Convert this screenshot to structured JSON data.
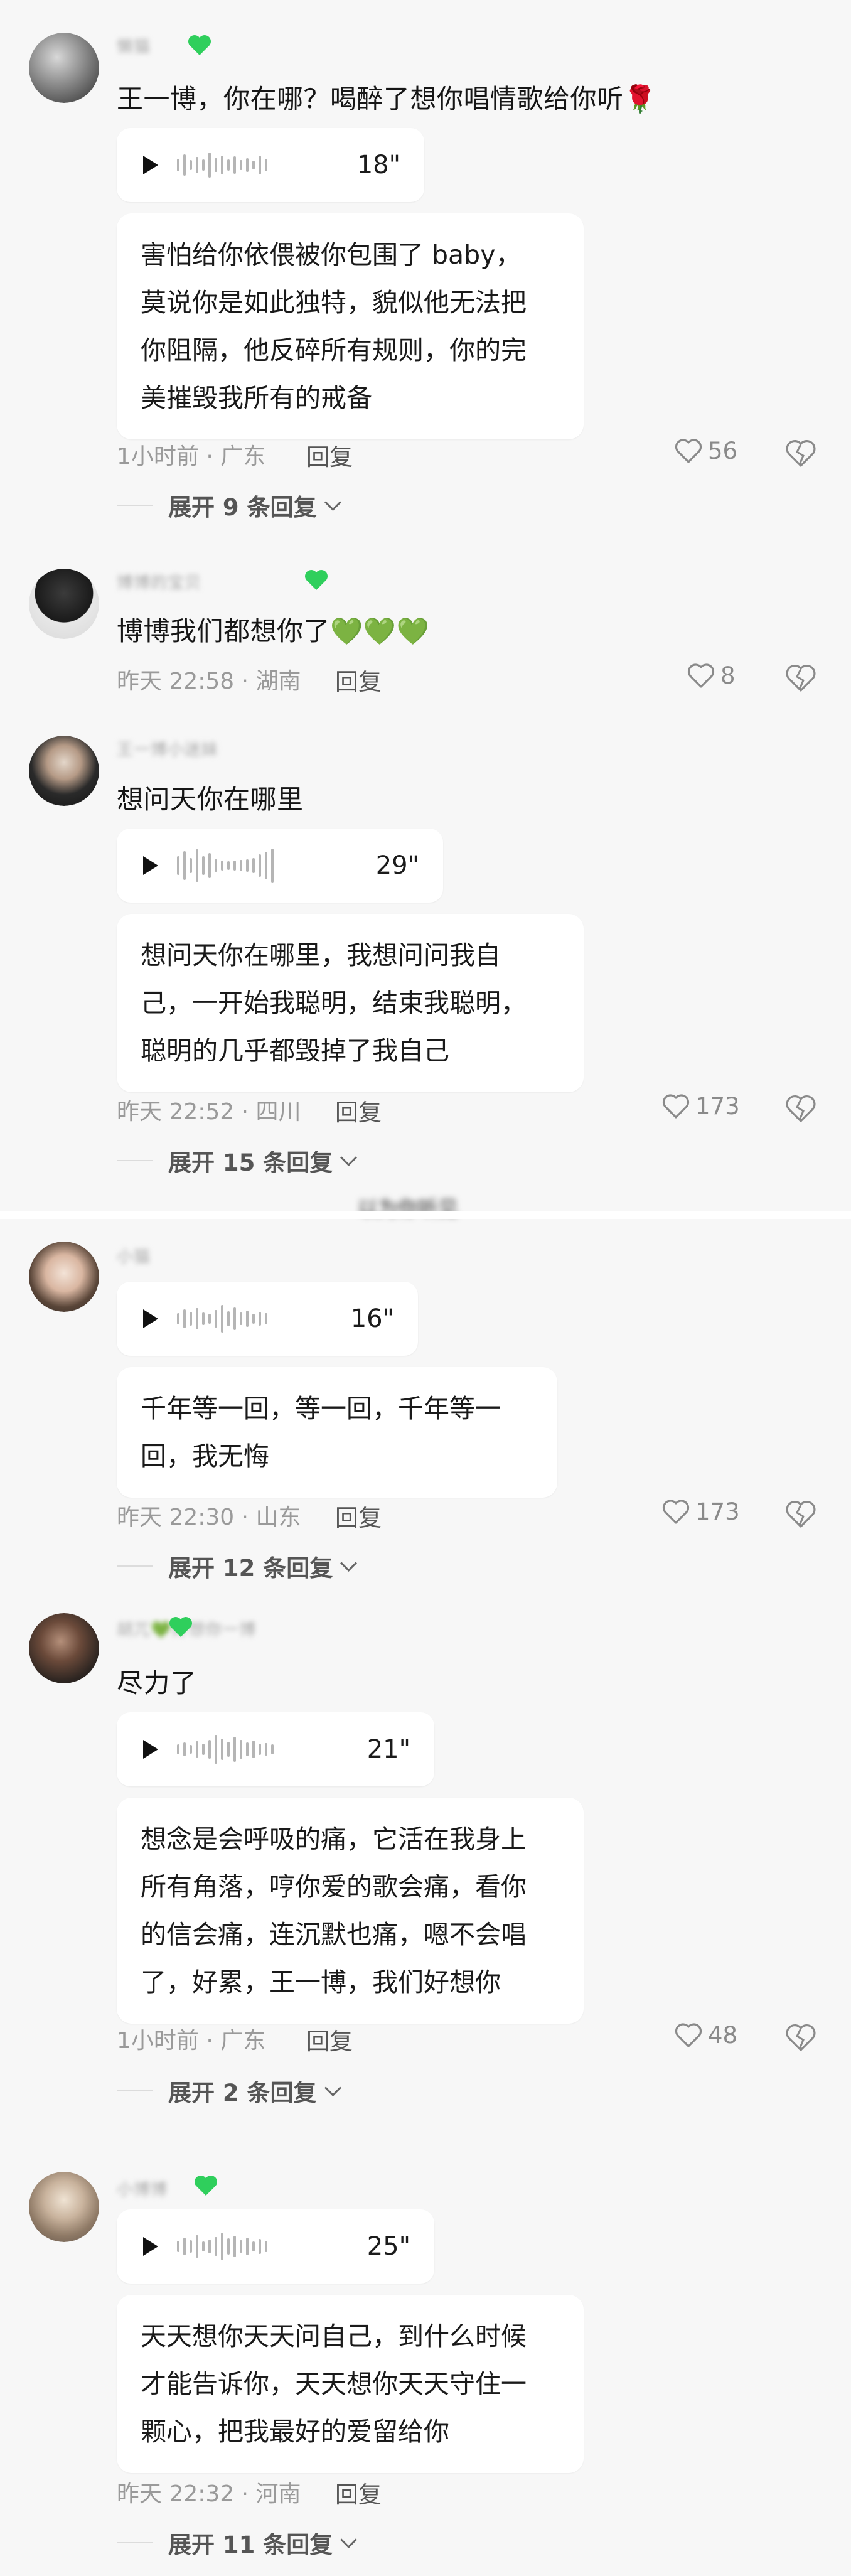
{
  "comments": [
    {
      "username": "懒猫",
      "text": "王一博，你在哪？喝醉了想你唱情歌给你听🌹",
      "voice_duration": "18\"",
      "transcript": [
        "害怕给你依偎被你包围了 baby，",
        "莫说你是如此独特，貌似他无法把",
        "你阻隔，他反碎所有规则，你的完",
        "美摧毁我所有的戒备"
      ],
      "time": "1小时前",
      "region": "广东",
      "reply_label": "回复",
      "likes": "56",
      "expand_label": "展开 9 条回复"
    },
    {
      "username": "博博的宝贝",
      "text": "博博我们都想你了💚💚💚",
      "time": "昨天 22:58",
      "region": "湖南",
      "reply_label": "回复",
      "likes": "8"
    },
    {
      "username": "王一博小迷妹",
      "text": "想问天你在哪里",
      "voice_duration": "29\"",
      "transcript": [
        "想问天你在哪里，我想问问我自",
        "己，一开始我聪明，结束我聪明，",
        "聪明的几乎都毁掉了我自己"
      ],
      "time": "昨天 22:52",
      "region": "四川",
      "reply_label": "回复",
      "likes": "173",
      "expand_label": "展开 15 条回复"
    },
    {
      "username": "小猫",
      "voice_duration": "16\"",
      "transcript": [
        "千年等一回，等一回，千年等一",
        "回，我无悔"
      ],
      "time": "昨天 22:30",
      "region": "山东",
      "reply_label": "回复",
      "likes": "173",
      "expand_label": "展开 12 条回复"
    },
    {
      "username": "胡兀💚好想你一博",
      "text": "尽力了",
      "voice_duration": "21\"",
      "transcript": [
        "想念是会呼吸的痛，它活在我身上",
        "所有角落，哼你爱的歌会痛，看你",
        "的信会痛，连沉默也痛，嗯不会唱",
        "了，好累，王一博，我们好想你"
      ],
      "time": "1小时前",
      "region": "广东",
      "reply_label": "回复",
      "likes": "48",
      "expand_label": "展开 2 条回复"
    },
    {
      "username": "小博博",
      "voice_duration": "25\"",
      "transcript": [
        "天天想你天天问自己，到什么时候",
        "才能告诉你，天天想你天天守住一",
        "颗心，把我最好的爱留给你"
      ],
      "time": "昨天 22:32",
      "region": "河南",
      "reply_label": "回复",
      "expand_label": "展开 11 条回复"
    }
  ],
  "divider_text": "以为你听见",
  "colors": {
    "badge_green": "#2fcf5c",
    "heart_green": "#27c93f",
    "rose_red": "#d0142c",
    "meta_gray": "#9a9a9a"
  },
  "icons": {
    "play": "play-icon",
    "like": "heart-outline-icon",
    "dislike": "broken-heart-icon",
    "expand": "chevron-down-icon"
  }
}
